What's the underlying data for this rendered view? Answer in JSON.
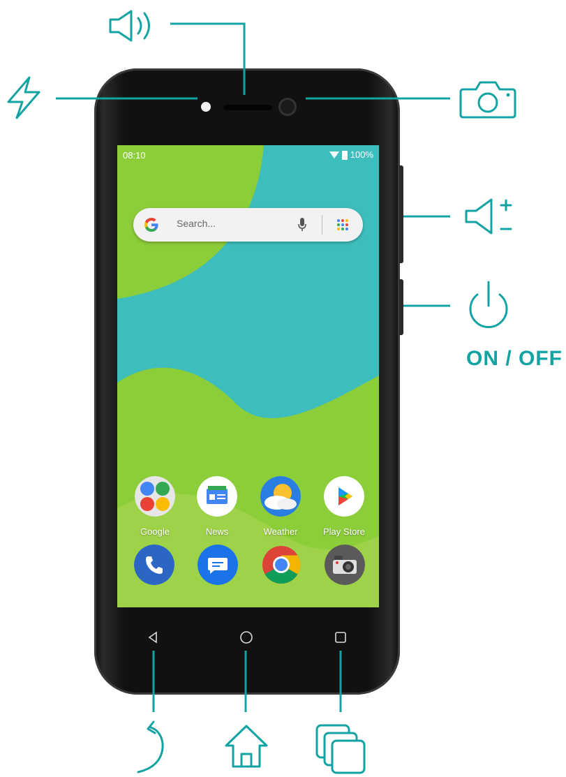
{
  "status_bar": {
    "time": "08:10",
    "battery": "100%",
    "wifi_icon": "wifi-icon",
    "battery_icon": "battery-icon"
  },
  "search": {
    "placeholder": "Search...",
    "google_icon": "google-g-icon",
    "mic_icon": "microphone-icon",
    "apps_icon": "app-grid-icon"
  },
  "apps": [
    {
      "label": "Google",
      "icon": "google-folder-icon"
    },
    {
      "label": "News",
      "icon": "news-icon"
    },
    {
      "label": "Weather",
      "icon": "weather-icon"
    },
    {
      "label": "Play Store",
      "icon": "play-store-icon"
    }
  ],
  "dock": [
    {
      "icon": "phone-icon"
    },
    {
      "icon": "messages-icon"
    },
    {
      "icon": "chrome-icon"
    },
    {
      "icon": "camera-app-icon"
    }
  ],
  "callouts": {
    "power_label": "ON / OFF",
    "icons": [
      "speaker-icon",
      "flash-icon",
      "camera-icon",
      "volume-icon",
      "power-icon",
      "back-icon",
      "home-icon",
      "recents-icon"
    ]
  },
  "colors": {
    "accent": "#13a3a3",
    "screen_teal": "#3dbdbc",
    "wallpaper_green": "#8ccd3a",
    "phone_body": "#111111"
  }
}
